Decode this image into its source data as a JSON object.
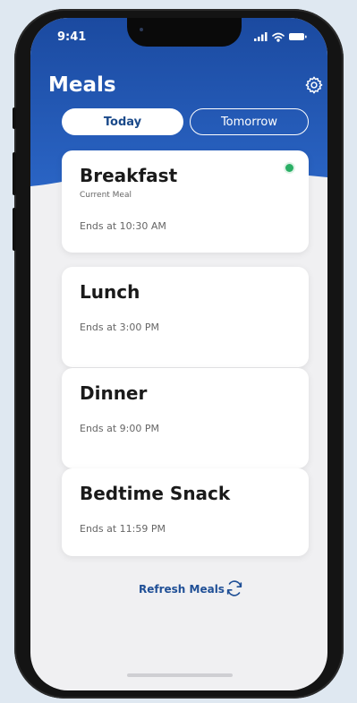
{
  "status": {
    "time": "9:41"
  },
  "header": {
    "title": "Meals"
  },
  "tabs": {
    "today": "Today",
    "tomorrow": "Tomorrow"
  },
  "meals": [
    {
      "name": "Breakfast",
      "subtitle": "Current Meal",
      "ends": "Ends at 10:30 AM",
      "active": true
    },
    {
      "name": "Lunch",
      "ends": "Ends at 3:00 PM"
    },
    {
      "name": "Dinner",
      "ends": "Ends at 9:00 PM"
    },
    {
      "name": "Bedtime Snack",
      "ends": "Ends at 11:59 PM"
    }
  ],
  "refresh": {
    "label": "Refresh Meals"
  },
  "colors": {
    "brand_blue": "#1f4f96",
    "active_green": "#2aaf65",
    "background": "#f0f0f2"
  },
  "icons": {
    "settings": "gear-icon",
    "refresh": "refresh-icon",
    "active": "active-dot"
  }
}
